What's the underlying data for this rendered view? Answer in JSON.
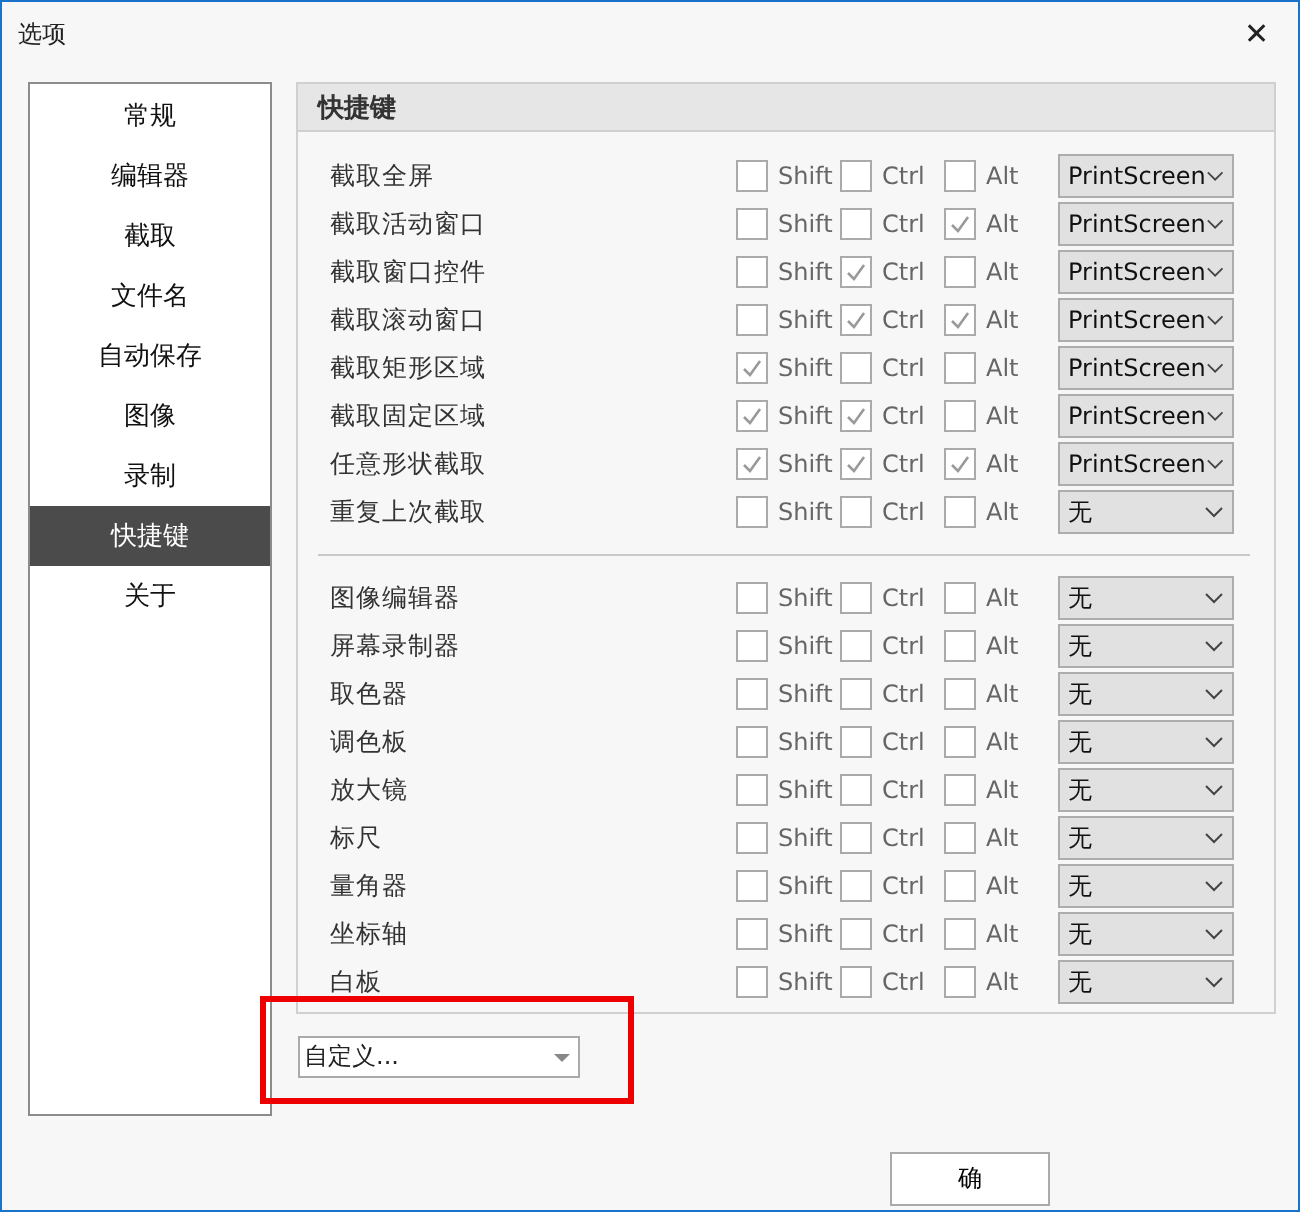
{
  "window": {
    "title": "选项",
    "close": "✕"
  },
  "sidebar": {
    "items": [
      {
        "label": "常规",
        "selected": false
      },
      {
        "label": "编辑器",
        "selected": false
      },
      {
        "label": "截取",
        "selected": false
      },
      {
        "label": "文件名",
        "selected": false
      },
      {
        "label": "自动保存",
        "selected": false
      },
      {
        "label": "图像",
        "selected": false
      },
      {
        "label": "录制",
        "selected": false
      },
      {
        "label": "快捷键",
        "selected": true
      },
      {
        "label": "关于",
        "selected": false
      }
    ]
  },
  "panel": {
    "title": "快捷键",
    "groups": [
      {
        "rows": [
          {
            "label": "截取全屏",
            "modifiers": [
              {
                "label": "Shift",
                "checked": false
              },
              {
                "label": "Ctrl",
                "checked": false
              },
              {
                "label": "Alt",
                "checked": false
              }
            ],
            "key": "PrintScreen"
          },
          {
            "label": "截取活动窗口",
            "modifiers": [
              {
                "label": "Shift",
                "checked": false
              },
              {
                "label": "Ctrl",
                "checked": false
              },
              {
                "label": "Alt",
                "checked": true
              }
            ],
            "key": "PrintScreen"
          },
          {
            "label": "截取窗口控件",
            "modifiers": [
              {
                "label": "Shift",
                "checked": false
              },
              {
                "label": "Ctrl",
                "checked": true
              },
              {
                "label": "Alt",
                "checked": false
              }
            ],
            "key": "PrintScreen"
          },
          {
            "label": "截取滚动窗口",
            "modifiers": [
              {
                "label": "Shift",
                "checked": false
              },
              {
                "label": "Ctrl",
                "checked": true
              },
              {
                "label": "Alt",
                "checked": true
              }
            ],
            "key": "PrintScreen"
          },
          {
            "label": "截取矩形区域",
            "modifiers": [
              {
                "label": "Shift",
                "checked": true
              },
              {
                "label": "Ctrl",
                "checked": false
              },
              {
                "label": "Alt",
                "checked": false
              }
            ],
            "key": "PrintScreen"
          },
          {
            "label": "截取固定区域",
            "modifiers": [
              {
                "label": "Shift",
                "checked": true
              },
              {
                "label": "Ctrl",
                "checked": true
              },
              {
                "label": "Alt",
                "checked": false
              }
            ],
            "key": "PrintScreen"
          },
          {
            "label": "任意形状截取",
            "modifiers": [
              {
                "label": "Shift",
                "checked": true
              },
              {
                "label": "Ctrl",
                "checked": true
              },
              {
                "label": "Alt",
                "checked": true
              }
            ],
            "key": "PrintScreen"
          },
          {
            "label": "重复上次截取",
            "modifiers": [
              {
                "label": "Shift",
                "checked": false
              },
              {
                "label": "Ctrl",
                "checked": false
              },
              {
                "label": "Alt",
                "checked": false
              }
            ],
            "key": "无"
          }
        ]
      },
      {
        "rows": [
          {
            "label": "图像编辑器",
            "modifiers": [
              {
                "label": "Shift",
                "checked": false
              },
              {
                "label": "Ctrl",
                "checked": false
              },
              {
                "label": "Alt",
                "checked": false
              }
            ],
            "key": "无"
          },
          {
            "label": "屏幕录制器",
            "modifiers": [
              {
                "label": "Shift",
                "checked": false
              },
              {
                "label": "Ctrl",
                "checked": false
              },
              {
                "label": "Alt",
                "checked": false
              }
            ],
            "key": "无"
          },
          {
            "label": "取色器",
            "modifiers": [
              {
                "label": "Shift",
                "checked": false
              },
              {
                "label": "Ctrl",
                "checked": false
              },
              {
                "label": "Alt",
                "checked": false
              }
            ],
            "key": "无"
          },
          {
            "label": "调色板",
            "modifiers": [
              {
                "label": "Shift",
                "checked": false
              },
              {
                "label": "Ctrl",
                "checked": false
              },
              {
                "label": "Alt",
                "checked": false
              }
            ],
            "key": "无"
          },
          {
            "label": "放大镜",
            "modifiers": [
              {
                "label": "Shift",
                "checked": false
              },
              {
                "label": "Ctrl",
                "checked": false
              },
              {
                "label": "Alt",
                "checked": false
              }
            ],
            "key": "无"
          },
          {
            "label": "标尺",
            "modifiers": [
              {
                "label": "Shift",
                "checked": false
              },
              {
                "label": "Ctrl",
                "checked": false
              },
              {
                "label": "Alt",
                "checked": false
              }
            ],
            "key": "无"
          },
          {
            "label": "量角器",
            "modifiers": [
              {
                "label": "Shift",
                "checked": false
              },
              {
                "label": "Ctrl",
                "checked": false
              },
              {
                "label": "Alt",
                "checked": false
              }
            ],
            "key": "无"
          },
          {
            "label": "坐标轴",
            "modifiers": [
              {
                "label": "Shift",
                "checked": false
              },
              {
                "label": "Ctrl",
                "checked": false
              },
              {
                "label": "Alt",
                "checked": false
              }
            ],
            "key": "无"
          },
          {
            "label": "白板",
            "modifiers": [
              {
                "label": "Shift",
                "checked": false
              },
              {
                "label": "Ctrl",
                "checked": false
              },
              {
                "label": "Alt",
                "checked": false
              }
            ],
            "key": "无"
          }
        ]
      }
    ]
  },
  "preset": {
    "value": "自定义..."
  },
  "buttons": [
    "确"
  ]
}
